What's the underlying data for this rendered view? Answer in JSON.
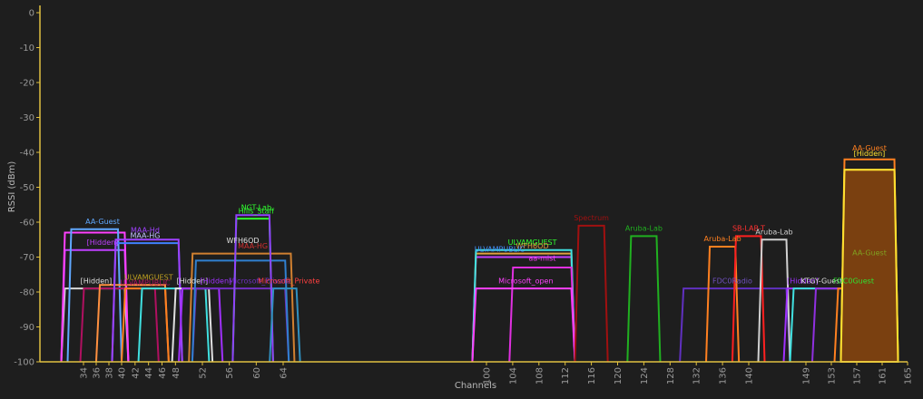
{
  "chart_data": {
    "type": "area",
    "title": "",
    "xlabel": "Channels",
    "ylabel": "RSSI (dBm)",
    "ylim": [
      -100,
      0
    ],
    "xlim": [
      30,
      165
    ],
    "yticks": [
      0,
      -10,
      -20,
      -30,
      -40,
      -50,
      -60,
      -70,
      -80,
      -90,
      -100
    ],
    "xticks": [
      {
        "v": 34,
        "label": "34"
      },
      {
        "v": 36,
        "label": "36"
      },
      {
        "v": 38,
        "label": "38"
      },
      {
        "v": 40,
        "label": "40"
      },
      {
        "v": 42,
        "label": "42"
      },
      {
        "v": 44,
        "label": "44"
      },
      {
        "v": 46,
        "label": "46"
      },
      {
        "v": 48,
        "label": "48"
      },
      {
        "v": 52,
        "label": "52"
      },
      {
        "v": 56,
        "label": "56"
      },
      {
        "v": 60,
        "label": "60"
      },
      {
        "v": 64,
        "label": "64"
      },
      {
        "v": 100,
        "label": "100"
      },
      {
        "v": 104,
        "label": "104"
      },
      {
        "v": 108,
        "label": "108"
      },
      {
        "v": 112,
        "label": "112"
      },
      {
        "v": 116,
        "label": "116"
      },
      {
        "v": 120,
        "label": "120"
      },
      {
        "v": 124,
        "label": "124"
      },
      {
        "v": 128,
        "label": "128"
      },
      {
        "v": 132,
        "label": "132"
      },
      {
        "v": 136,
        "label": "136"
      },
      {
        "v": 140,
        "label": "140"
      },
      {
        "v": 149,
        "label": "149"
      },
      {
        "v": 153,
        "label": "153"
      },
      {
        "v": 157,
        "label": "157"
      },
      {
        "v": 161,
        "label": "161"
      },
      {
        "v": 165,
        "label": "165"
      }
    ],
    "grid": false,
    "colors": {
      "background": "#1e1e1e",
      "axis": "#e0c040",
      "tick_text": "#9a9a9a"
    },
    "series": [
      {
        "name": "[Hidden]",
        "ch_lo": 30.5,
        "ch_hi": 41,
        "rssi": -79,
        "color": "#d8d8d8"
      },
      {
        "name": "[Hidden]",
        "ch_lo": 30.5,
        "ch_hi": 41,
        "rssi": -68,
        "color": "#c040ff"
      },
      {
        "name": "AA-Guest",
        "ch_lo": 30.5,
        "ch_hi": 41,
        "rssi": -63,
        "color": "#ff40ff"
      },
      {
        "name": "AA-Guest",
        "ch_lo": 31.5,
        "ch_hi": 40,
        "rssi": -62,
        "color": "#60a8ff"
      },
      {
        "name": "ULVAMGUEST",
        "ch_lo": 33.5,
        "ch_hi": 45.5,
        "rssi": -79,
        "color": "#b01060"
      },
      {
        "name": "ULVAMPUBLIC",
        "ch_lo": 36,
        "ch_hi": 47,
        "rssi": -78,
        "color": "#ff9040"
      },
      {
        "name": "",
        "ch_lo": 40,
        "ch_hi": 47,
        "rssi": -79,
        "color": "#ff8020"
      },
      {
        "name": "[Hidden]",
        "ch_lo": 38.5,
        "ch_hi": 49,
        "rssi": -66,
        "color": "#4080ff"
      },
      {
        "name": "MAA-HG",
        "ch_lo": 38.5,
        "ch_hi": 49,
        "rssi": -65,
        "color": "#a040ff"
      },
      {
        "name": "",
        "ch_lo": 42.5,
        "ch_hi": 53,
        "rssi": -79,
        "color": "#40e0e0"
      },
      {
        "name": "[Hidden]",
        "ch_lo": 47.5,
        "ch_hi": 53.5,
        "rssi": -79,
        "color": "#e0e0e0"
      },
      {
        "name": "[Hidden]",
        "ch_lo": 48.5,
        "ch_hi": 55,
        "rssi": -79,
        "color": "#a030ff"
      },
      {
        "name": "",
        "ch_lo": 50.5,
        "ch_hi": 65,
        "rssi": -79,
        "color": "#7030c0"
      },
      {
        "name": "WFH6OD",
        "ch_lo": 50,
        "ch_hi": 66,
        "rssi": -69,
        "color": "#d08030"
      },
      {
        "name": "",
        "ch_lo": 50.5,
        "ch_hi": 65,
        "rssi": -71,
        "color": "#3080d0"
      },
      {
        "name": "",
        "ch_lo": 56.5,
        "ch_hi": 62.5,
        "rssi": -59,
        "color": "#30ff30"
      },
      {
        "name": "",
        "ch_lo": 56.5,
        "ch_hi": 62.5,
        "rssi": -58,
        "color": "#9040ff"
      },
      {
        "name": "",
        "ch_lo": 62,
        "ch_hi": 67,
        "rssi": -79,
        "color": "#3090c0"
      },
      {
        "name": "",
        "ch_lo": 97.5,
        "ch_hi": 113.5,
        "rssi": -70,
        "color": "#c040ff"
      },
      {
        "name": "",
        "ch_lo": 97.5,
        "ch_hi": 113.5,
        "rssi": -69,
        "color": "#e0a040"
      },
      {
        "name": "ULVAMGUEST",
        "ch_lo": 97.5,
        "ch_hi": 113.5,
        "rssi": -68,
        "color": "#40e0e0"
      },
      {
        "name": "aa-mist",
        "ch_lo": 103.5,
        "ch_hi": 113.5,
        "rssi": -73,
        "color": "#e030e0"
      },
      {
        "name": "Microsoft_open",
        "ch_lo": 97.5,
        "ch_hi": 113.5,
        "rssi": -79,
        "color": "#ff40ff"
      },
      {
        "name": "",
        "ch_lo": 113.5,
        "ch_hi": 118.5,
        "rssi": -61,
        "color": "#a01010"
      },
      {
        "name": "Aruba-Lab",
        "ch_lo": 121.5,
        "ch_hi": 126.5,
        "rssi": -64,
        "color": "#20b020"
      },
      {
        "name": "",
        "ch_lo": 129.5,
        "ch_hi": 146.5,
        "rssi": -79,
        "color": "#6030c0"
      },
      {
        "name": "Aruba-Lab",
        "ch_lo": 133.5,
        "ch_hi": 138.5,
        "rssi": -67,
        "color": "#ff8020"
      },
      {
        "name": "SB-LAB-T",
        "ch_lo": 137.5,
        "ch_hi": 142.5,
        "rssi": -64,
        "color": "#ff2020"
      },
      {
        "name": "Aruba-Lab",
        "ch_lo": 141.5,
        "ch_hi": 146.5,
        "rssi": -65,
        "color": "#d0d0d0"
      },
      {
        "name": "[Hidden]",
        "ch_lo": 145.5,
        "ch_hi": 156,
        "rssi": -79,
        "color": "#a030ff"
      },
      {
        "name": "",
        "ch_lo": 146.5,
        "ch_hi": 163,
        "rssi": -79,
        "color": "#40e0e0"
      },
      {
        "name": "",
        "ch_lo": 150,
        "ch_hi": 156,
        "rssi": -79,
        "color": "#9030e0"
      },
      {
        "name": "",
        "ch_lo": 153.5,
        "ch_hi": 160,
        "rssi": -79,
        "color": "#ff8020"
      },
      {
        "name": "[Hidden]",
        "ch_lo": 154.5,
        "ch_hi": 163.5,
        "rssi": -42,
        "color": "#ff8020"
      },
      {
        "name": "",
        "ch_lo": 155.5,
        "ch_hi": 163,
        "rssi": -71,
        "color": "#80a020"
      },
      {
        "name": "",
        "ch_lo": 154.5,
        "ch_hi": 163.5,
        "rssi": -45,
        "color": "#ffe030",
        "fill": true
      }
    ],
    "annotations": [
      {
        "text": "AA-Guest",
        "ch": 37,
        "rssi": -60.5,
        "color": "#60a8ff"
      },
      {
        "text": "[Hidden]",
        "ch": 37,
        "rssi": -66.5,
        "color": "#c040ff"
      },
      {
        "text": "[Hidden]",
        "ch": 36,
        "rssi": -77.5,
        "color": "#e0e0e0"
      },
      {
        "text": "ULVAMGUEST",
        "ch": 44,
        "rssi": -76.5,
        "color": "#c0a020"
      },
      {
        "text": "ULVAMPUBLIC",
        "ch": 43.5,
        "rssi": -78,
        "color": "#b01060"
      },
      {
        "text": "MAA-Hd",
        "ch": 43.5,
        "rssi": -63,
        "color": "#a040ff"
      },
      {
        "text": "MAA-HG",
        "ch": 43.5,
        "rssi": -64.5,
        "color": "#c0c0ff"
      },
      {
        "text": "[Hidden]",
        "ch": 50.5,
        "rssi": -77.5,
        "color": "#e0e0e0"
      },
      {
        "text": "[Hidden]",
        "ch": 54,
        "rssi": -77.5,
        "color": "#a030ff"
      },
      {
        "text": "WFH6OD",
        "ch": 58,
        "rssi": -66,
        "color": "#e0e0e0"
      },
      {
        "text": "MAA-HG",
        "ch": 59.5,
        "rssi": -67.5,
        "color": "#d03030"
      },
      {
        "text": "NGT-Lab",
        "ch": 60,
        "rssi": -56.5,
        "color": "#30ff30"
      },
      {
        "text": "Hills_Staff",
        "ch": 60,
        "rssi": -57.5,
        "color": "#30ff30"
      },
      {
        "text": "Microsoft_Private",
        "ch": 60.5,
        "rssi": -77.5,
        "color": "#7030c0"
      },
      {
        "text": "Microsoft_Private",
        "ch": 65,
        "rssi": -77.5,
        "color": "#ff4040"
      },
      {
        "text": "ULVAMGUEST",
        "ch": 107,
        "rssi": -66.5,
        "color": "#30ff30"
      },
      {
        "text": "WFH6OD",
        "ch": 107,
        "rssi": -67.5,
        "color": "#e0a040"
      },
      {
        "text": "ULVAMPUBLIC",
        "ch": 102,
        "rssi": -68.5,
        "color": "#4090ff"
      },
      {
        "text": "aa-mist",
        "ch": 108.5,
        "rssi": -71,
        "color": "#ff40ff"
      },
      {
        "text": "Microsoft_open",
        "ch": 106,
        "rssi": -77.5,
        "color": "#ff40ff"
      },
      {
        "text": "Spectrum",
        "ch": 116,
        "rssi": -59.5,
        "color": "#a01010"
      },
      {
        "text": "Aruba-Lab",
        "ch": 124,
        "rssi": -62.5,
        "color": "#20b020"
      },
      {
        "text": "Aruba-Lab",
        "ch": 136,
        "rssi": -65.5,
        "color": "#ff8020"
      },
      {
        "text": "SB-LAB-T",
        "ch": 140,
        "rssi": -62.5,
        "color": "#ff3030"
      },
      {
        "text": "Aruba-Lab",
        "ch": 144,
        "rssi": -63.5,
        "color": "#d0d0d0"
      },
      {
        "text": "FDC0Radio",
        "ch": 137.5,
        "rssi": -77.5,
        "color": "#7050c0"
      },
      {
        "text": "[Hidden]",
        "ch": 148.5,
        "rssi": -77.5,
        "color": "#a030ff"
      },
      {
        "text": "KTGY-Guest",
        "ch": 151.5,
        "rssi": -77.5,
        "color": "#e0e0e0"
      },
      {
        "text": "FDC0Guest",
        "ch": 156.5,
        "rssi": -77.5,
        "color": "#30e030"
      },
      {
        "text": "AA-Guest",
        "ch": 159,
        "rssi": -39.5,
        "color": "#ff8020"
      },
      {
        "text": "[Hidden]",
        "ch": 159,
        "rssi": -41,
        "color": "#ffe030"
      },
      {
        "text": "AA-Guest",
        "ch": 159,
        "rssi": -69.5,
        "color": "#80a020"
      }
    ]
  }
}
